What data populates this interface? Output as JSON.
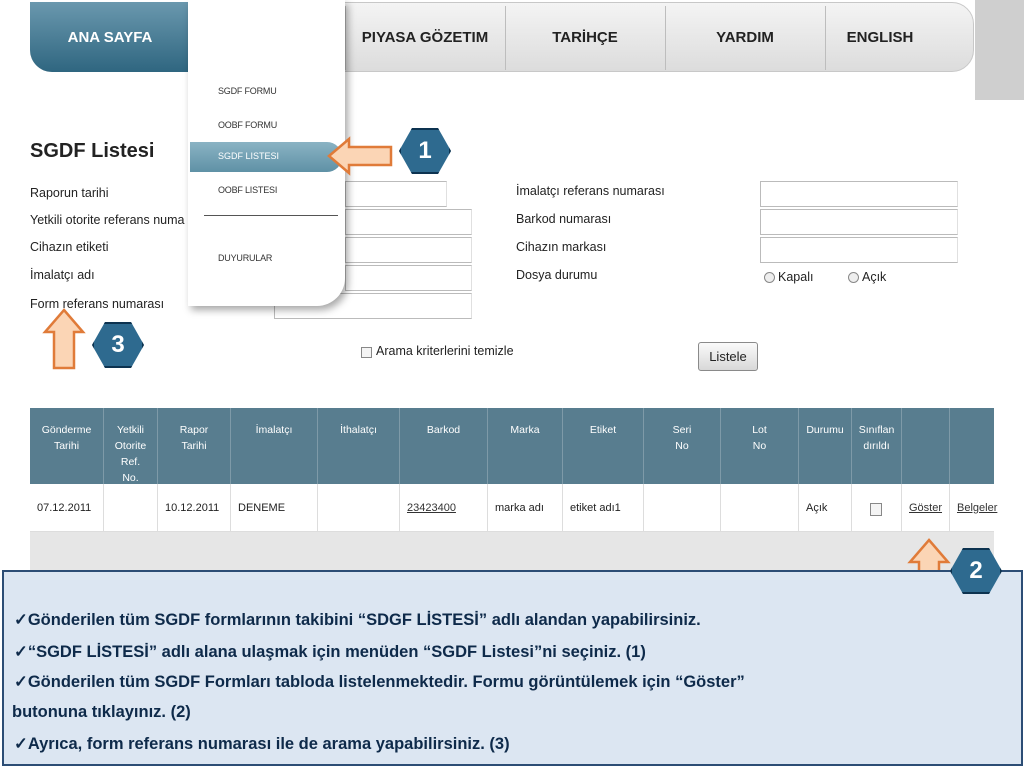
{
  "nav": {
    "home": "ANA SAYFA",
    "market": "PIYASA GÖZETIM",
    "history": "TARİHÇE",
    "help": "YARDIM",
    "english": "ENGLISH"
  },
  "dropdown": {
    "items": [
      "SGDF FORMU",
      "OOBF FORMU",
      "SGDF LISTESI",
      "OOBF LISTESI",
      "DUYURULAR"
    ],
    "active": "SGDF LISTESI"
  },
  "form": {
    "title": "SGDF Listesi",
    "left_labels": [
      "Raporun tarihi",
      "Yetkili otorite referans numa",
      "Cihazın etiketi",
      "İmalatçı adı",
      "Form referans numarası"
    ],
    "right_labels": [
      "İmalatçı referans numarası",
      "Barkod numarası",
      "Cihazın markası",
      "Dosya durumu"
    ],
    "radio_closed": "Kapalı",
    "radio_open": "Açık",
    "clear_checkbox": "Arama kriterlerini temizle",
    "list_button": "Listele"
  },
  "table": {
    "headers": [
      "Gönderme Tarihi",
      "Yetkili Otorite Ref. No.",
      "Rapor Tarihi",
      "İmalatçı",
      "İthalatçı",
      "Barkod",
      "Marka",
      "Etiket",
      "Seri No",
      "Lot No",
      "Durumu",
      "Sınıflan dırıldı",
      "",
      ""
    ],
    "row": {
      "send_date": "07.12.2011",
      "authority_ref": "",
      "report_date": "10.12.2011",
      "manufacturer": "DENEME",
      "importer": "",
      "barcode": "23423400",
      "brand": "marka adı",
      "label": "etiket adı1",
      "serial": "",
      "lot": "",
      "status": "Açık",
      "show": "Göster",
      "documents": "Belgeler"
    }
  },
  "badges": [
    "1",
    "2",
    "3"
  ],
  "info": {
    "line1": "✓Gönderilen tüm SGDF formlarının takibini “SDGF LİSTESİ” adlı alandan yapabilirsiniz.",
    "line2": "✓“SGDF LİSTESİ” adlı alana ulaşmak için menüden “SGDF Listesi”ni seçiniz. (1)",
    "line3": "✓Gönderilen tüm SGDF Formları tabloda listelenmektedir. Formu görüntülemek için “Göster”",
    "line4": "butonuna tıklayınız. (2)",
    "line5": "✓Ayrıca, form referans numarası ile de arama yapabilirsiniz. (3)"
  },
  "colors": {
    "nav_active": "#2f6680",
    "table_header": "#587d8f",
    "arrow_fill": "#fbd5b5",
    "arrow_stroke": "#e07b39",
    "badge_fill": "#2e6a8f",
    "info_bg": "#dce6f2",
    "info_border": "#2c4d75"
  }
}
